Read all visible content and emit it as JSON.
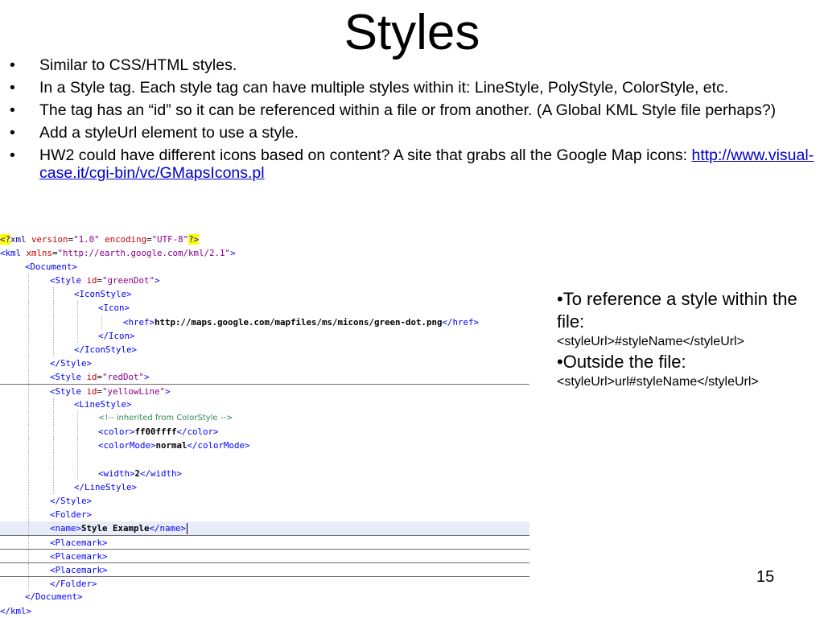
{
  "slide": {
    "title": "Styles",
    "page_number": "15"
  },
  "bullets": [
    {
      "text": "Similar to CSS/HTML styles."
    },
    {
      "text": "In a Style tag.  Each style tag can have multiple styles within it: LineStyle, PolyStyle, ColorStyle, etc."
    },
    {
      "text": "The tag has an “id” so it can be referenced within a file or from another. (A Global KML Style file perhaps?)"
    },
    {
      "text": "Add a styleUrl element to use a style."
    },
    {
      "text": "HW2 could have different icons based on content?  A site that grabs all the Google Map icons: ",
      "link": "http://www.visual-case.it/cgi-bin/vc/GMapsIcons.pl"
    }
  ],
  "bullet_symbol": "•",
  "side_notes": {
    "line1": "•To reference a style within the file:",
    "line2": "<styleUrl>#styleName</styleUrl>",
    "line3": "•Outside the file:",
    "line4": "<styleUrl>url#styleName</styleUrl>"
  },
  "code": {
    "l1": {
      "pi_open": "<?",
      "name": "xml",
      "a1": "version",
      "v1": "\"1.0\"",
      "a2": "encoding",
      "v2": "\"UTF-8\"",
      "pi_close": "?>"
    },
    "l2": {
      "open": "<kml ",
      "attr": "xmlns",
      "val": "\"http://earth.google.com/kml/2.1\"",
      "close": ">"
    },
    "l3": "<Document>",
    "l4": {
      "open": "<Style ",
      "attr": "id",
      "val": "\"greenDot\"",
      "close": ">"
    },
    "l5": "<IconStyle>",
    "l6": "<Icon>",
    "l7": {
      "open": "<href>",
      "text": "http://maps.google.com/mapfiles/ms/micons/green-dot.png",
      "close": "</href>"
    },
    "l8": "</Icon>",
    "l9": "</IconStyle>",
    "l10": "</Style>",
    "l11": {
      "open": "<Style ",
      "attr": "id",
      "val": "\"redDot\"",
      "close": ">"
    },
    "l12": {
      "open": "<Style ",
      "attr": "id",
      "val": "\"yellowLine\"",
      "close": ">"
    },
    "l13": "<LineStyle>",
    "l14": "<!-- inherited from ColorStyle -->",
    "l15": {
      "open": "<color>",
      "text": "ff00ffff",
      "close": "</color>"
    },
    "l16": {
      "open": "<colorMode>",
      "text": "normal",
      "close": "</colorMode>"
    },
    "l18": {
      "open": "<width>",
      "text": "2",
      "close": "</width>"
    },
    "l19": "</LineStyle>",
    "l20": "</Style>",
    "l21": "<Folder>",
    "l22": {
      "open": "<name>",
      "text": "Style Example",
      "close": "</name>"
    },
    "l23": "<Placemark>",
    "l24": "<Placemark>",
    "l25": "<Placemark>",
    "l26": "</Folder>",
    "l27": "</Document>",
    "l28": "</kml>"
  }
}
